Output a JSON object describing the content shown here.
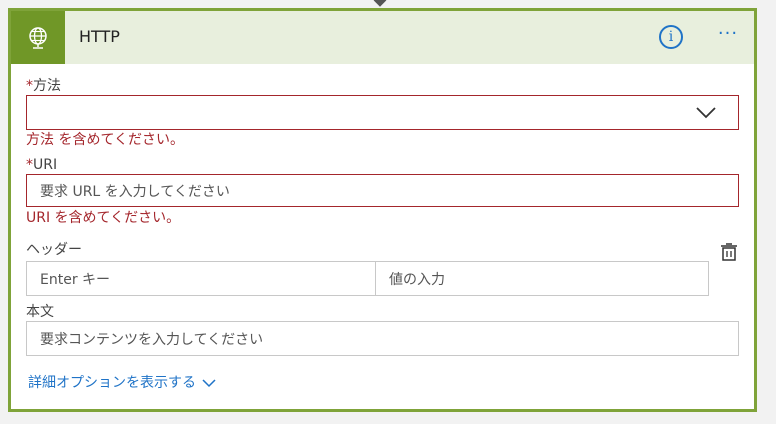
{
  "card": {
    "title": "HTTP",
    "icon": "globe-icon",
    "info_icon": "info-icon",
    "more_icon": "ellipsis-icon",
    "more_label": "···",
    "info_label": "i",
    "accent_color": "#709727",
    "border_color": "#7fa339"
  },
  "method": {
    "required_mark": "*",
    "label": "方法",
    "value": "",
    "error": "方法 を含めてください。"
  },
  "uri": {
    "required_mark": "*",
    "label": "URI",
    "placeholder": "要求 URL を入力してください",
    "error": "URI を含めてください。"
  },
  "headers": {
    "label": "ヘッダー",
    "key_placeholder": "Enter キー",
    "value_placeholder": "値の入力"
  },
  "body": {
    "label": "本文",
    "placeholder": "要求コンテンツを入力してください"
  },
  "advanced": {
    "label": "詳細オプションを表示する"
  },
  "colors": {
    "error": "#a4262c",
    "link": "#1f73c7"
  }
}
